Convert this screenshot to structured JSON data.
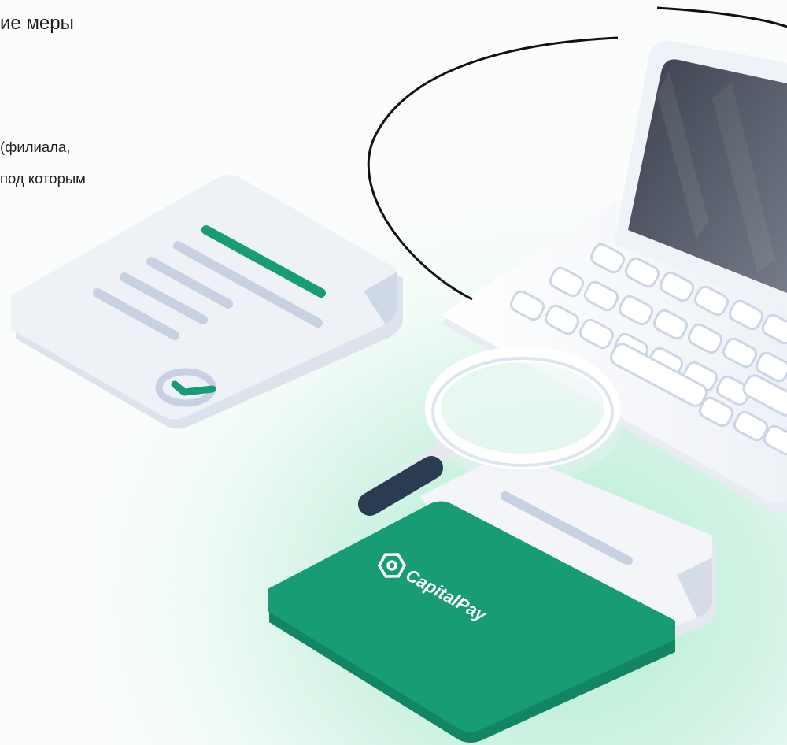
{
  "heading": "ие меры",
  "body_lines": [
    "(филиала,",
    "под которым"
  ],
  "brand": {
    "name": "CapitalPay",
    "logo_icon": "capitalpay-logo-icon",
    "accent_color": "#179c76"
  },
  "illustration_icons": [
    "document-icon",
    "checkmark-icon",
    "laptop-icon",
    "magnifier-icon",
    "folder-icon"
  ]
}
